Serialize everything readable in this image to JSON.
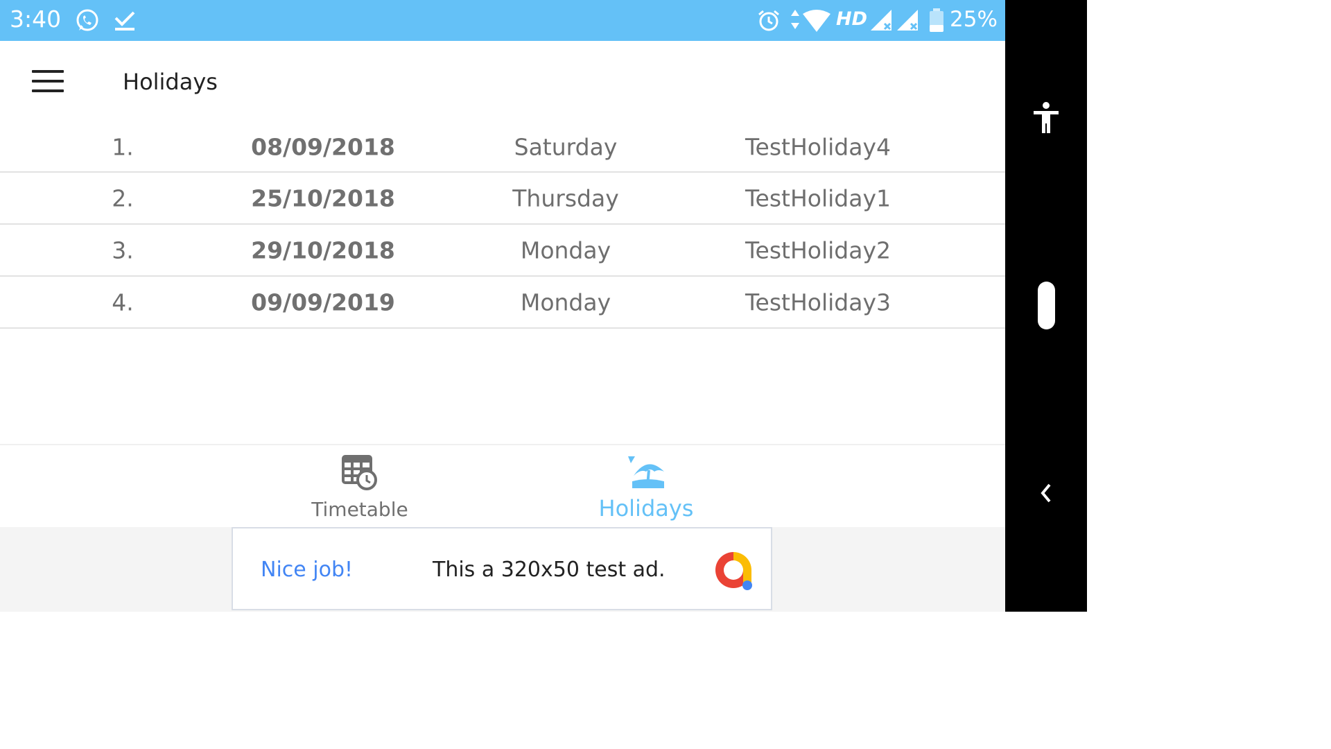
{
  "status_bar": {
    "time": "3:40",
    "hd": "HD",
    "battery": "25%",
    "icons": [
      "whatsapp-icon",
      "download-done-icon",
      "alarm-icon",
      "data-arrows-icon",
      "wifi-icon",
      "signal-icon",
      "signal-icon",
      "battery-icon"
    ],
    "background": "#64c1f7"
  },
  "app_bar": {
    "title": "Holidays",
    "menu_icon": "hamburger-menu-icon"
  },
  "holidays": [
    {
      "num": "1.",
      "date": "08/09/2018",
      "day": "Saturday",
      "name": "TestHoliday4"
    },
    {
      "num": "2.",
      "date": "25/10/2018",
      "day": "Thursday",
      "name": "TestHoliday1"
    },
    {
      "num": "3.",
      "date": "29/10/2018",
      "day": "Monday",
      "name": "TestHoliday2"
    },
    {
      "num": "4.",
      "date": "09/09/2019",
      "day": "Monday",
      "name": "TestHoliday3"
    }
  ],
  "bottom_nav": {
    "items": [
      {
        "label": "Timetable",
        "icon": "timetable-icon",
        "active": false
      },
      {
        "label": "Holidays",
        "icon": "beach-umbrella-icon",
        "active": true
      }
    ],
    "active_color": "#64c1f7"
  },
  "ad": {
    "headline": "Nice job!",
    "text": "This a 320x50 test ad.",
    "logo": "admob-logo-icon"
  },
  "side_panel": {
    "icons": [
      "accessibility-icon",
      "back-chevron-icon"
    ]
  }
}
